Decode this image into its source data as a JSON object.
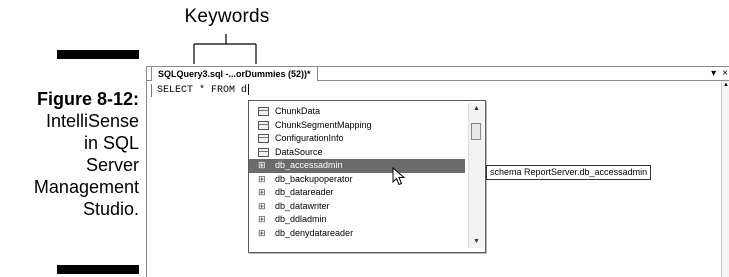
{
  "callout": {
    "label": "Keywords"
  },
  "figure": {
    "number": "Figure 8-12:",
    "caption": "IntelliSense\nin SQL\nServer\nManagement\nStudio."
  },
  "editor": {
    "tab_title": "SQLQuery3.sql -...orDummies (52))*",
    "tab_controls": [
      "▾",
      "×"
    ],
    "code": "SELECT * FROM d"
  },
  "completion_list": {
    "items": [
      {
        "label": "ChunkData",
        "icon": "table-icon",
        "selected": false
      },
      {
        "label": "ChunkSegmentMapping",
        "icon": "table-icon",
        "selected": false
      },
      {
        "label": "ConfigurationInfo",
        "icon": "table-icon",
        "selected": false
      },
      {
        "label": "DataSource",
        "icon": "table-icon",
        "selected": false
      },
      {
        "label": "db_accessadmin",
        "icon": "schema-icon",
        "selected": true
      },
      {
        "label": "db_backupoperator",
        "icon": "schema-icon",
        "selected": false
      },
      {
        "label": "db_datareader",
        "icon": "schema-icon",
        "selected": false
      },
      {
        "label": "db_datawriter",
        "icon": "schema-icon",
        "selected": false
      },
      {
        "label": "db_ddladmin",
        "icon": "schema-icon",
        "selected": false
      },
      {
        "label": "db_denydatareader",
        "icon": "schema-icon",
        "selected": false
      }
    ]
  },
  "tooltip": {
    "text": "schema ReportServer.db_accessadmin"
  }
}
